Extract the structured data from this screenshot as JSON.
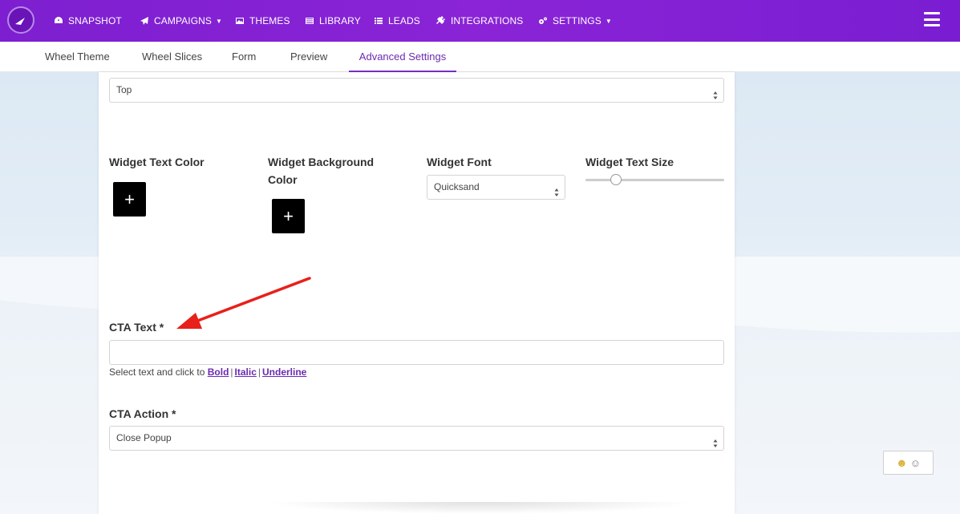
{
  "nav": {
    "items": [
      {
        "label": "SNAPSHOT",
        "icon": "dashboard-icon"
      },
      {
        "label": "CAMPAIGNS",
        "icon": "paper-plane-icon",
        "caret": true
      },
      {
        "label": "THEMES",
        "icon": "image-icon"
      },
      {
        "label": "LIBRARY",
        "icon": "list-alt-icon"
      },
      {
        "label": "LEADS",
        "icon": "list-icon"
      },
      {
        "label": "INTEGRATIONS",
        "icon": "plug-icon"
      },
      {
        "label": "SETTINGS",
        "icon": "cogs-icon",
        "caret": true
      }
    ]
  },
  "tabs": [
    {
      "label": "Wheel Theme"
    },
    {
      "label": "Wheel Slices"
    },
    {
      "label": "Form"
    },
    {
      "label": "Preview"
    },
    {
      "label": "Advanced Settings",
      "active": true
    }
  ],
  "form": {
    "position_select": "Top",
    "widget_text_color_label": "Widget Text Color",
    "widget_bg_color_label": "Widget Background Color",
    "widget_font_label": "Widget Font",
    "widget_font_value": "Quicksand",
    "widget_text_size_label": "Widget Text Size",
    "widget_text_size_level": 0.22,
    "add_symbol": "+",
    "cta_text_label": "CTA Text *",
    "cta_text_value": "",
    "helper_prefix": "Select text and click to",
    "helper_bold": "Bold",
    "helper_italic": "Italic",
    "helper_underline": "Underline",
    "helper_sep": "|",
    "cta_action_label": "CTA Action *",
    "cta_action_value": "Close Popup"
  },
  "colors": {
    "nav_bg": "#7d1fd0",
    "accent": "#6b2ab0",
    "annotation_arrow": "#e8201a"
  }
}
